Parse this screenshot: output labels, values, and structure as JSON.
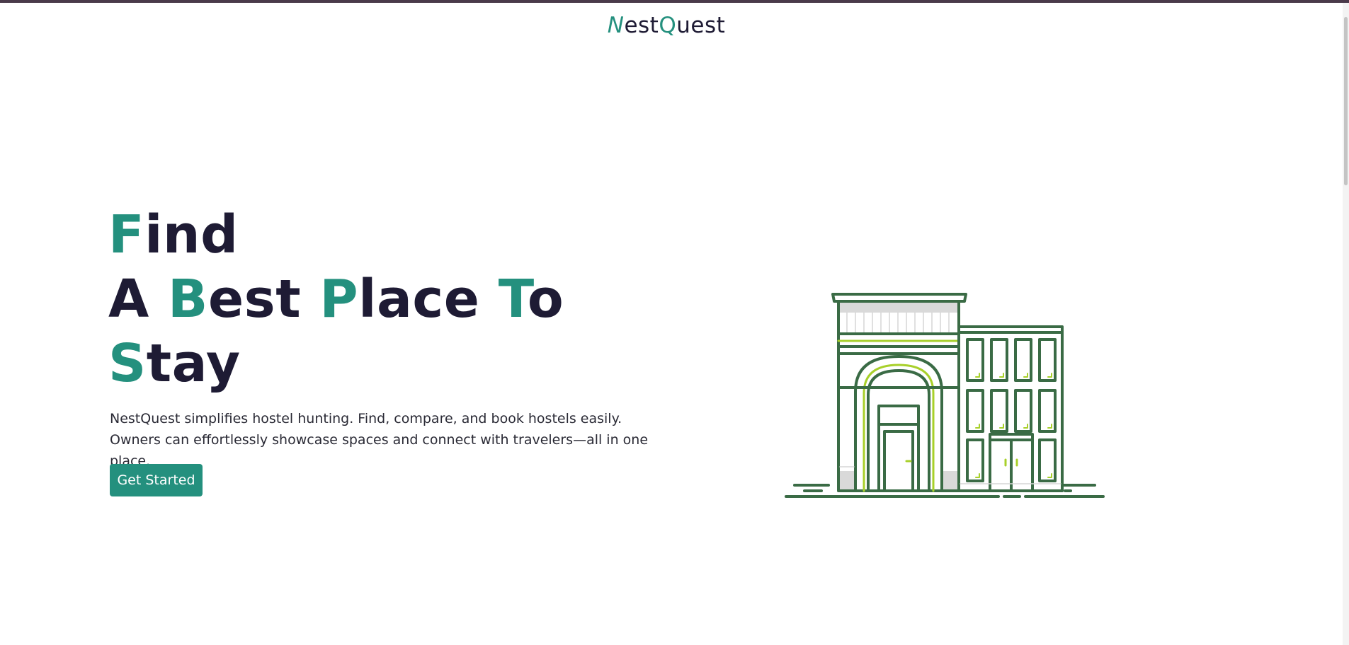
{
  "brand": {
    "n": "N",
    "est": "est",
    "q": "Q",
    "uest": "uest"
  },
  "hero": {
    "line1": {
      "f": "F",
      "ind": "ind"
    },
    "line2": {
      "a": "A ",
      "b": "B",
      "est": "est ",
      "p": "P",
      "lace": "lace ",
      "t": "T",
      "o": "o"
    },
    "line3": {
      "s": "S",
      "tay": "tay"
    },
    "description": "NestQuest simplifies hostel hunting. Find, compare, and book hostels easily. Owners can effortlessly showcase spaces and connect with travelers—all in one place.",
    "cta_label": "Get Started"
  },
  "colors": {
    "accent": "#24907e",
    "heading": "#1e1b34",
    "illustration_stroke": "#3a6b45",
    "illustration_highlight": "#a8d02a"
  },
  "icons": {
    "illustration": "building-illustration"
  }
}
